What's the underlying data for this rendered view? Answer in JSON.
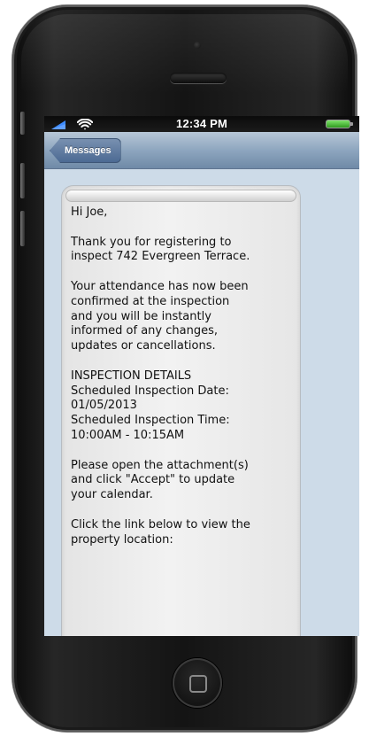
{
  "status_bar": {
    "time": "12:34 PM",
    "icons": [
      "signal-icon",
      "wifi-icon",
      "battery-icon"
    ],
    "battery_color": "#3fbd2c"
  },
  "nav_bar": {
    "back_label": "Messages",
    "colors": {
      "nav": "#8ea6bf",
      "back_button": "#4c6a93"
    }
  },
  "message": {
    "greeting": "Hi Joe,",
    "para1": [
      "Thank you for registering to",
      "inspect 742 Evergreen Terrace."
    ],
    "para2": [
      "Your attendance has now been",
      "confirmed at the inspection",
      "and you will be instantly",
      "informed of any changes,",
      "updates or cancellations."
    ],
    "details": [
      "INSPECTION DETAILS",
      "Scheduled Inspection Date:",
      "01/05/2013",
      "Scheduled Inspection Time:",
      "10:00AM - 10:15AM"
    ],
    "para3": [
      "Please open the attachment(s)",
      "and click \"Accept\" to update",
      "your calendar."
    ],
    "para4": [
      "Click the link below to view the",
      "property location:"
    ]
  },
  "device": {
    "icons": [
      "camera-icon",
      "earpiece-icon",
      "home-button-icon"
    ],
    "colors": {
      "body": "#141414",
      "screen_background": "#cddbe8",
      "bubble": "#f2f2f2"
    }
  }
}
